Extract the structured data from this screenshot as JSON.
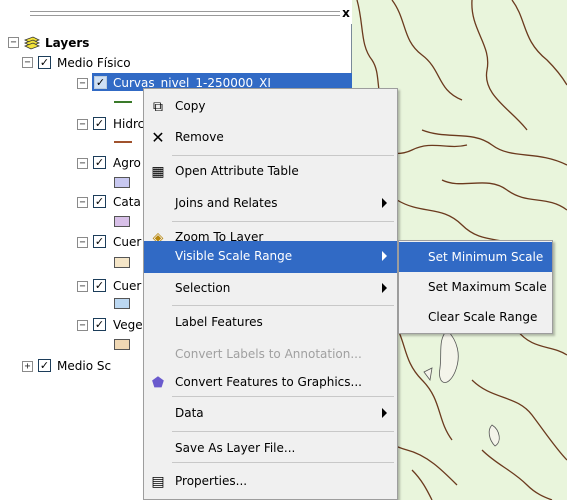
{
  "toc": {
    "close_glyph": "x",
    "root_label": "Layers",
    "groups": [
      {
        "label": "Medio Físico",
        "expanded": true
      },
      {
        "label": "Medio Sc",
        "expanded": false
      }
    ],
    "layers": [
      {
        "label": "Curvas_nivel_1-250000_XI",
        "checked": true,
        "selected": true,
        "symbol": "line",
        "color": "#3a7a2a"
      },
      {
        "label": "Hidrc",
        "checked": true,
        "symbol": "line",
        "color": "#a0522d"
      },
      {
        "label": "Agro",
        "checked": true,
        "symbol": "fill",
        "color": "#c8c8f0"
      },
      {
        "label": "Cata",
        "checked": true,
        "symbol": "fill",
        "color": "#d8c0e8"
      },
      {
        "label": "Cuer",
        "checked": true,
        "symbol": "fill",
        "color": "#f5e6c8"
      },
      {
        "label": "Cuer",
        "checked": true,
        "symbol": "fill",
        "color": "#bcd8f2"
      },
      {
        "label": "Vege",
        "checked": true,
        "symbol": "fill",
        "color": "#f0d8b4"
      }
    ]
  },
  "context_menu": {
    "items": [
      {
        "label": "Copy",
        "icon": "copy-icon"
      },
      {
        "label": "Remove",
        "icon": "remove-icon"
      },
      {
        "label": "Open Attribute Table",
        "icon": "table-icon"
      },
      {
        "label": "Joins and Relates",
        "submenu": true
      },
      {
        "label": "Zoom To Layer",
        "icon": "zoom-to-layer-icon"
      },
      {
        "label": "Visible Scale Range",
        "submenu": true,
        "highlighted": true
      },
      {
        "label": "Selection",
        "submenu": true
      },
      {
        "label": "Label Features"
      },
      {
        "label": "Convert Labels to Annotation...",
        "disabled": true
      },
      {
        "label": "Convert Features to Graphics...",
        "icon": "convert-graphics-icon"
      },
      {
        "label": "Data",
        "submenu": true
      },
      {
        "label": "Save As Layer File..."
      },
      {
        "label": "Properties...",
        "icon": "properties-icon"
      }
    ]
  },
  "submenu": {
    "items": [
      {
        "label": "Set Minimum Scale",
        "highlighted": true
      },
      {
        "label": "Set Maximum Scale"
      },
      {
        "label": "Clear Scale Range"
      }
    ]
  },
  "colors": {
    "highlight": "#316ac5",
    "menu_bg": "#f0f0f0",
    "map_bg": "#e9f5dc",
    "contour": "#6b3a1e"
  }
}
